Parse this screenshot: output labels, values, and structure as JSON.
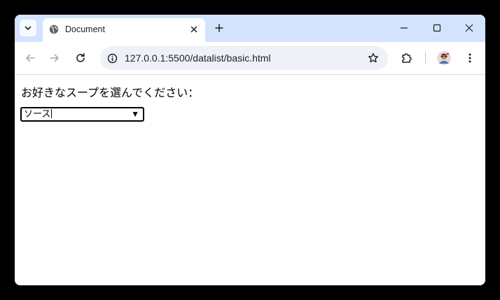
{
  "browser": {
    "tab": {
      "title": "Document",
      "favicon": "globe-icon"
    },
    "address_bar": {
      "url": "127.0.0.1:5500/datalist/basic.html"
    },
    "icons": {
      "tab_search": "chevron-down-icon",
      "tab_close": "close-icon",
      "new_tab": "plus-icon",
      "minimize": "minimize-icon",
      "maximize": "maximize-icon",
      "close_window": "close-icon",
      "back": "arrow-left-icon",
      "forward": "arrow-right-icon",
      "reload": "reload-icon",
      "site_info": "info-icon",
      "bookmark": "star-icon",
      "extensions": "puzzle-icon",
      "menu": "more-vert-icon"
    },
    "colors": {
      "titlebar": "#d3e3fd",
      "omnibox": "#eef1f8"
    }
  },
  "page": {
    "prompt_label": "お好きなスープを選んでください：",
    "soup_input": {
      "value": "ソース",
      "dropdown_arrow": "▼"
    }
  }
}
